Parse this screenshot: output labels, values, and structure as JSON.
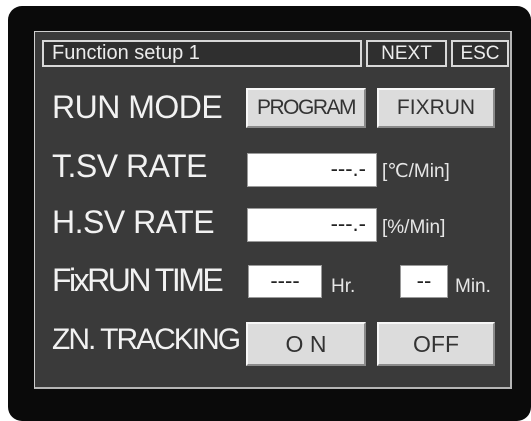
{
  "header": {
    "title": "Function setup 1",
    "next_label": "NEXT",
    "esc_label": "ESC"
  },
  "run_mode": {
    "label": "RUN MODE",
    "program_label": "PROGRAM",
    "fixrun_label": "FIXRUN"
  },
  "tsv_rate": {
    "label": "T.SV RATE",
    "value": "---.-",
    "unit": "[℃/Min]"
  },
  "hsv_rate": {
    "label": "H.SV RATE",
    "value": "---.-",
    "unit": "[%/Min]"
  },
  "fixrun_time": {
    "label": "FixRUN TIME",
    "hours_value": "----",
    "hours_unit": "Hr.",
    "minutes_value": "--",
    "minutes_unit": "Min."
  },
  "zn_tracking": {
    "label": "ZN. TRACKING",
    "on_label": "O N",
    "off_label": "OFF"
  }
}
